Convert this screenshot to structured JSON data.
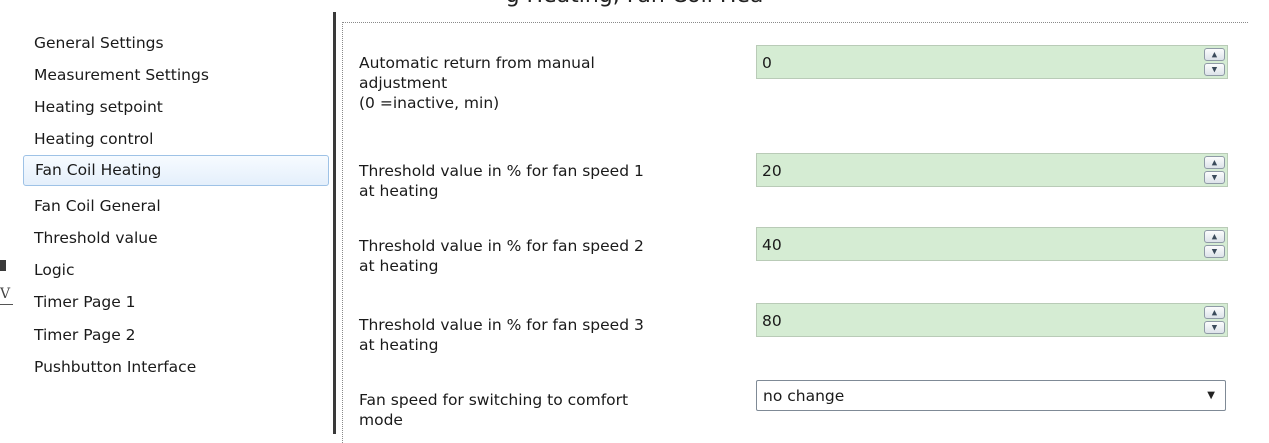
{
  "top_caption": "g Heating, Fan Coil Hea",
  "edge_glyph": "V",
  "sidebar": {
    "items": [
      {
        "label": "General Settings"
      },
      {
        "label": "Measurement Settings"
      },
      {
        "label": "Heating setpoint"
      },
      {
        "label": "Heating control"
      },
      {
        "label": "Fan Coil Heating",
        "selected": true
      },
      {
        "label": "Fan Coil General"
      },
      {
        "label": "Threshold value"
      },
      {
        "label": "Logic"
      },
      {
        "label": "Timer Page 1"
      },
      {
        "label": "Timer Page 2"
      },
      {
        "label": "Pushbutton Interface"
      }
    ]
  },
  "params": [
    {
      "label_lines": [
        "Automatic return from manual",
        "adjustment",
        "(0 =inactive, min)"
      ],
      "value": "0"
    },
    {
      "label_lines": [
        "Threshold value in % for fan speed 1",
        "at heating"
      ],
      "value": "20"
    },
    {
      "label_lines": [
        "Threshold value in % for fan speed 2",
        "at heating"
      ],
      "value": "40"
    },
    {
      "label_lines": [
        "Threshold value in % for fan speed 3",
        "at heating"
      ],
      "value": "80"
    },
    {
      "label_lines": [
        "Fan speed for switching to comfort",
        "mode"
      ],
      "value": "no change"
    }
  ],
  "icons": {
    "spin_up": "up-arrow-icon",
    "spin_down": "down-arrow-icon",
    "dropdown": "dropdown-arrow-icon"
  },
  "colors": {
    "input_bg": "#d5ecd3",
    "selection_border": "#9ec2e6"
  }
}
